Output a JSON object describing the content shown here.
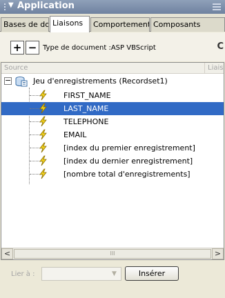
{
  "panel": {
    "title": "Application",
    "collapse_glyph": "▼"
  },
  "tabs": [
    {
      "label": "Bases de données",
      "active": false
    },
    {
      "label": "Liaisons",
      "active": true
    },
    {
      "label": "Comportements serveur",
      "active": false
    },
    {
      "label": "Composants",
      "active": false
    }
  ],
  "toolbar": {
    "add_label": "+",
    "remove_label": "−",
    "doc_type": "Type de document :ASP VBScript",
    "refresh_label": "C"
  },
  "columns": {
    "source": "Source",
    "liaison": "Liais"
  },
  "recordset": {
    "label": "Jeu d'enregistrements (Recordset1)",
    "expander": "−"
  },
  "fields": [
    {
      "label": "FIRST_NAME",
      "selected": false
    },
    {
      "label": "LAST_NAME",
      "selected": true
    },
    {
      "label": "TELEPHONE",
      "selected": false
    },
    {
      "label": "EMAIL",
      "selected": false
    },
    {
      "label": "[index du premier enregistrement]",
      "selected": false
    },
    {
      "label": "[index du dernier enregistrement]",
      "selected": false
    },
    {
      "label": "[nombre total d'enregistrements]",
      "selected": false
    }
  ],
  "scrollbar": {
    "left_arrow": "<",
    "right_arrow": ">",
    "thumb_grip": "III"
  },
  "bottom": {
    "lier_label": "Lier à :",
    "select_arrow": "▼",
    "insert_label": "Insérer"
  },
  "colors": {
    "header": "#7a8cab",
    "selection": "#316ac5",
    "panel_bg": "#ece9d8"
  }
}
